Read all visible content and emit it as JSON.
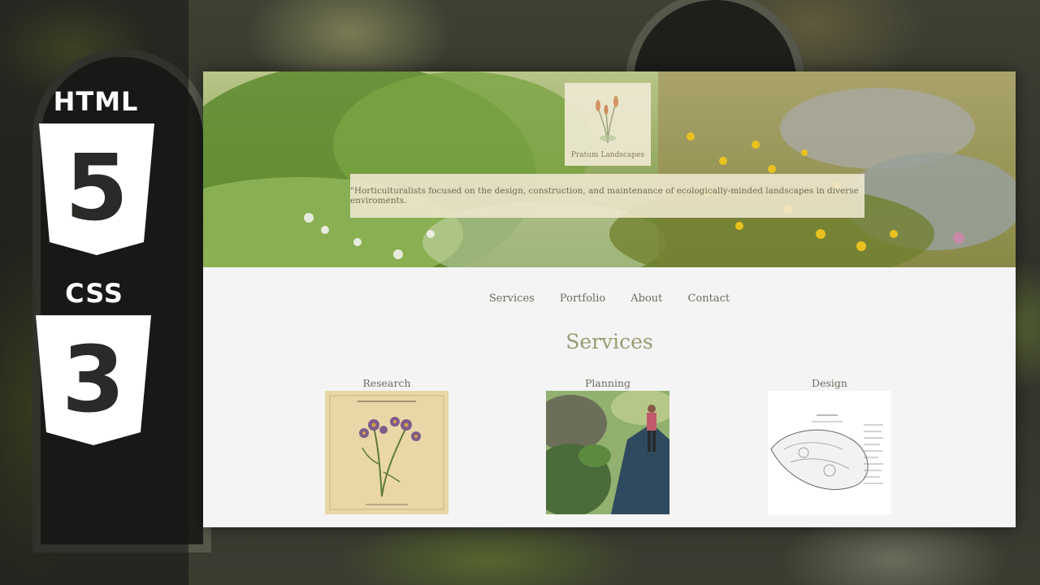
{
  "logos": {
    "html_label": "HTML",
    "html_number": "5",
    "css_label": "CSS",
    "css_number": "3"
  },
  "site": {
    "brand": "Pratum Landscapes",
    "tagline": "\"Horticulturalists focused on the design, construction, and maintenance of ecologically-minded landscapes in diverse enviroments."
  },
  "nav": {
    "items": [
      "Services",
      "Portfolio",
      "About",
      "Contact"
    ]
  },
  "services": {
    "title": "Services",
    "cards": [
      {
        "label": "Research",
        "image": "botanical-aster-print"
      },
      {
        "label": "Planning",
        "image": "person-on-garden-path-photo"
      },
      {
        "label": "Design",
        "image": "landscape-plan-drawing"
      }
    ]
  },
  "colors": {
    "panel_bg": "#f4f4f4",
    "title": "#9a9a74",
    "nav_text": "#6e6a5e",
    "tagline_bg": "#f0e8d0"
  }
}
